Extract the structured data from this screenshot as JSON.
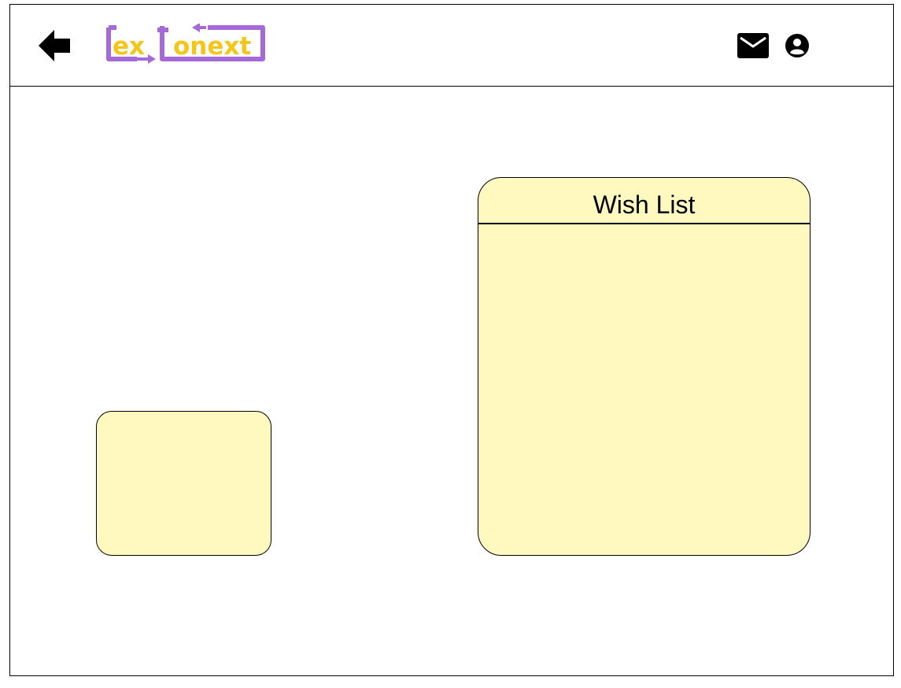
{
  "header": {
    "back_icon": "back-arrow-icon",
    "logo": {
      "part1": "ex",
      "part2": "onext",
      "colors": {
        "text": "#f5c518",
        "frame": "#a66ad8"
      }
    },
    "mail_icon": "mail-icon",
    "user_icon": "user-account-icon"
  },
  "main": {
    "wish_list": {
      "title": "Wish List"
    }
  },
  "colors": {
    "card_fill": "#fff9c0",
    "border": "#000000"
  }
}
